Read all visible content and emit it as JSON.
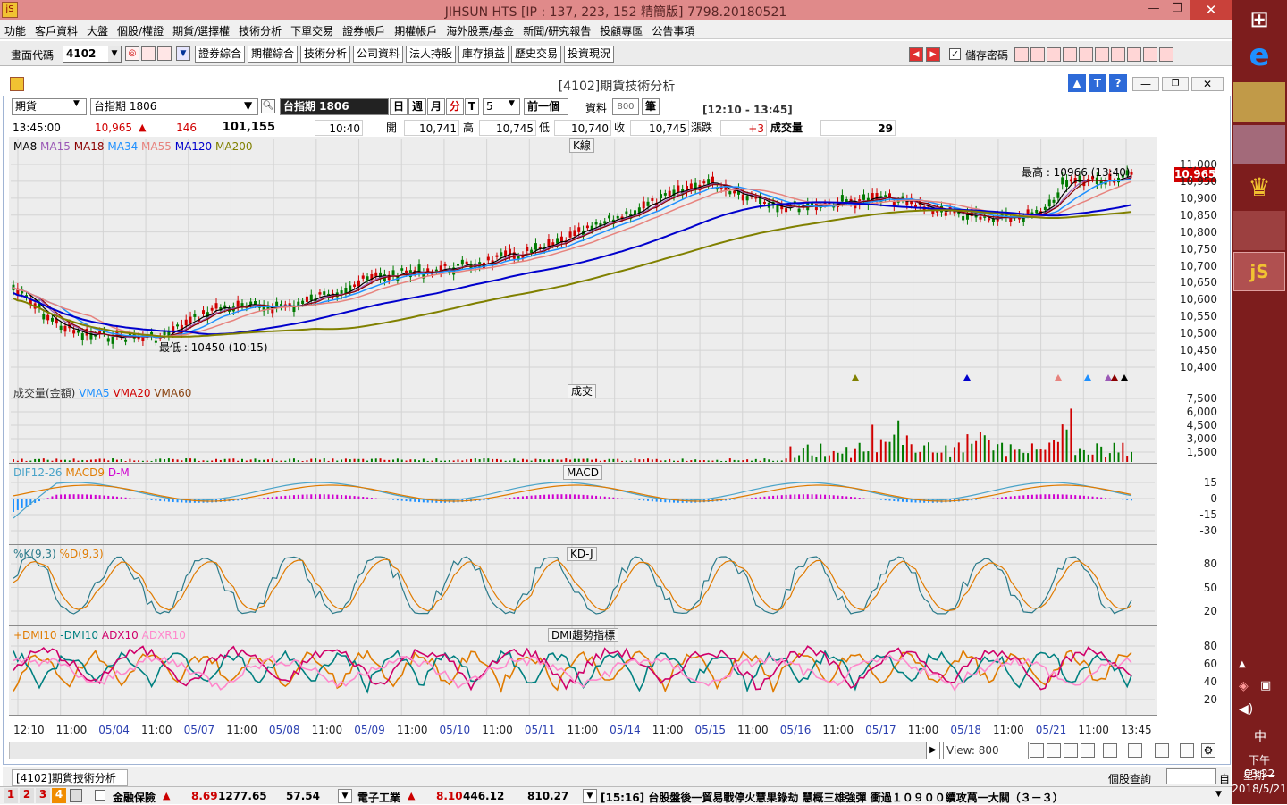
{
  "window": {
    "title": "JIHSUN HTS     [IP : 137, 223, 152 精簡版] 7798.20180521"
  },
  "menu": [
    "功能",
    "客戶資料",
    "大盤",
    "個股/權證",
    "期貨/選擇權",
    "技術分析",
    "下單交易",
    "證券帳戶",
    "期權帳戶",
    "海外股票/基金",
    "新聞/研究報告",
    "投顧專區",
    "公告事項"
  ],
  "toolbar": {
    "code_label": "畫面代碼",
    "code_value": "4102",
    "buttons": [
      "證券綜合",
      "期權綜合",
      "技術分析",
      "公司資料",
      "法人持股",
      "庫存損益",
      "歷史交易",
      "投資現況"
    ],
    "save_pwd_label": "儲存密碼"
  },
  "inner": {
    "title": "[4102]期貨技術分析",
    "market_select": "期貨",
    "symbol_input": "台指期 1806",
    "symbol_display": "台指期 1806",
    "periods": [
      "日",
      "週",
      "月",
      "分",
      "T"
    ],
    "interval_value": "5",
    "prev_button": "前一個",
    "data_label": "資料",
    "data_count": "800",
    "bars_label": "筆",
    "time_range": "[12:10 - 13:45]"
  },
  "quote": {
    "time": "13:45:00",
    "price": "10,965",
    "change": "146",
    "volume_total": "101,155",
    "bar_time": "10:40",
    "open_label": "開",
    "open": "10,741",
    "high_label": "高",
    "high": "10,745",
    "low_label": "低",
    "low": "10,740",
    "close_label": "收",
    "close": "10,745",
    "chg_label": "漲跌",
    "chg": "+3",
    "vol_label": "成交量",
    "vol": "29"
  },
  "panes": {
    "kline": {
      "title": "K線",
      "legend": [
        "MA8",
        "MA15",
        "MA18",
        "MA34",
        "MA55",
        "MA120",
        "MA200"
      ],
      "legend_colors": [
        "#000000",
        "#9b59b6",
        "#8b0000",
        "#1e90ff",
        "#e7837e",
        "#0000cc",
        "#808000"
      ],
      "high_note": "最高 : 10966 (13:40)",
      "low_note": "最低 : 10450 (10:15)",
      "last_price_tag": "10,965",
      "yticks": [
        "11,000",
        "10,950",
        "10,900",
        "10,850",
        "10,800",
        "10,750",
        "10,700",
        "10,650",
        "10,600",
        "10,550",
        "10,500",
        "10,450",
        "10,400"
      ]
    },
    "volume": {
      "title": "成交",
      "legend": [
        "成交量(金額)",
        "VMA5",
        "VMA20",
        "VMA60"
      ],
      "legend_colors": [
        "#333333",
        "#1e90ff",
        "#d00000",
        "#8b4513"
      ],
      "yticks": [
        "7,500",
        "6,000",
        "4,500",
        "3,000",
        "1,500"
      ]
    },
    "macd": {
      "title": "MACD",
      "legend": [
        "DIF12-26",
        "MACD9",
        "D-M"
      ],
      "legend_colors": [
        "#4aa3c8",
        "#e07b00",
        "#d000d0"
      ],
      "yticks": [
        "15",
        "0",
        "-15",
        "-30"
      ]
    },
    "kd": {
      "title": "KD-J",
      "legend": [
        "%K(9,3)",
        "%D(9,3)"
      ],
      "legend_colors": [
        "#2a7a8a",
        "#e07b00"
      ],
      "yticks": [
        "80",
        "50",
        "20"
      ]
    },
    "dmi": {
      "title": "DMI趨勢指標",
      "legend": [
        "+DMI10",
        "-DMI10",
        "ADX10",
        "ADXR10"
      ],
      "legend_colors": [
        "#e07b00",
        "#008080",
        "#d0006a",
        "#ff88cc"
      ],
      "yticks": [
        "80",
        "60",
        "40",
        "20"
      ]
    }
  },
  "xaxis": [
    "12:10",
    "11:00",
    "05/04",
    "11:00",
    "05/07",
    "11:00",
    "05/08",
    "11:00",
    "05/09",
    "11:00",
    "05/10",
    "11:00",
    "05/11",
    "11:00",
    "05/14",
    "11:00",
    "05/15",
    "11:00",
    "05/16",
    "11:00",
    "05/17",
    "11:00",
    "05/18",
    "11:00",
    "05/21",
    "11:00",
    "13:45"
  ],
  "view": {
    "label": "View:",
    "value": "800"
  },
  "statusbar": {
    "tab": "[4102]期貨技術分析",
    "query_label": "個股查詢",
    "self_label": "自"
  },
  "bottom": {
    "nums": [
      "1",
      "2",
      "3",
      "4"
    ],
    "stock1_name": "金融保險",
    "stock1_chg": "8.69",
    "stock1_idx": "1277.65",
    "stock1_vol": "57.54",
    "stock2_name": "電子工業",
    "stock2_chg": "8.10",
    "stock2_idx": "446.12",
    "stock2_vol": "810.27",
    "news": "[15:16] 台股盤後一貿易戰停火慧果錄劫 慧概三雄強彈 衝過１０９００續攻萬一大關（３－３）"
  },
  "taskbar": {
    "ime": "中",
    "time": "下午 03:22",
    "weekday": "星期一",
    "date": "2018/5/21"
  }
}
